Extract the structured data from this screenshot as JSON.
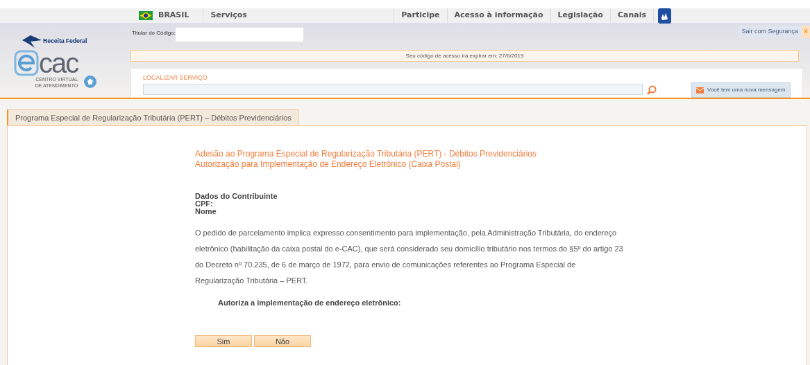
{
  "gov_bar": {
    "country": "BRASIL",
    "menu": [
      "Serviços"
    ],
    "links": [
      "Participe",
      "Acesso à informação",
      "Legislação",
      "Canais"
    ]
  },
  "header": {
    "brand": "Receita Federal",
    "logo_word": "cac",
    "logo_caption": "CENTRO VIRTUAL DE ATENDIMENTO",
    "holder_label": "Titular do Código:",
    "logout": "Sair com Segurança",
    "logout_close": "X",
    "expiry_notice": "Seu código de acesso irá expirar em: 27/6/2019",
    "search_label": "LOCALIZAR SERVIÇO",
    "message_button": "Você tem uma nova mensagem"
  },
  "tabs": [
    {
      "label": "Programa Especial de Regularização Tributária (PERT) – Débitos Previdenciários",
      "selected": true
    }
  ],
  "content": {
    "title": "Adesão ao Programa Especial de Regularização Tributária (PERT) - Débitos Previdenciários",
    "subtitle": "Autorização para Implementação de Endereço Eletrônico (Caixa Postal)",
    "taxpayer": [
      "Dados do Contribuinte",
      "CPF:",
      "Nome"
    ],
    "paragraph": "O pedido de parcelamento implica expresso consentimento para implementação, pela Administração Tributária, do endereço eletrônico (habilitação da caixa postal do e-CAC), que será considerado seu domicílio tributário nos termos do §5º do artigo 23 do Decreto nº 70.235, de 6 de março de 1972, para envio de comunicações referentes ao Programa Especial de Regularização Tributária – PERT.",
    "question": "Autoriza a implementação de endereço eletrônico:",
    "buttons": [
      "Sim",
      "Não"
    ]
  }
}
